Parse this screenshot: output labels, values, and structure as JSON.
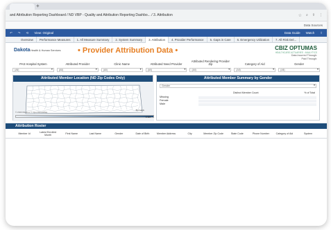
{
  "browser": {
    "url": "and Attribution Reporting Dashboard / ND VBP - Quality and Attribution Reporting Dashbo... / 3. Attribution",
    "right_items": [
      "Data Sources"
    ]
  },
  "toolbar": {
    "view": "View: Original",
    "data_guide": "Data Guide",
    "watch": "Watch"
  },
  "tabs": [
    {
      "label": "Overview",
      "active": false
    },
    {
      "label": "Performance Measures",
      "active": false
    },
    {
      "label": "1. All Measure Summary",
      "active": false
    },
    {
      "label": "2. System Summary",
      "active": false
    },
    {
      "label": "3. Attribution",
      "active": true
    },
    {
      "label": "4. Provider Performance",
      "active": false
    },
    {
      "label": "5. Gaps in Care",
      "active": false
    },
    {
      "label": "6. Emergency Utilization",
      "active": false
    },
    {
      "label": "7. All Risk Del...",
      "active": false
    }
  ],
  "header": {
    "logo": "Dakota",
    "logo_sub": "Health & Human Services",
    "title": "Provider Attribution Data",
    "title_decor": "•",
    "partner": "CBIZ OPTUMAS",
    "partner_sub": "HEALTHCARE ACTUARIES · ANALYTICS",
    "dates": [
      "Data Incurred Through:",
      "Paid Through:"
    ]
  },
  "filters": [
    {
      "label": "PAS Hospital System",
      "value": "(All)"
    },
    {
      "label": "Attributed Provider",
      "value": "(All)"
    },
    {
      "label": "Clinic Name",
      "value": "(All)"
    },
    {
      "label": "Attributed Need Provider",
      "value": "(All)"
    },
    {
      "label": "Attributed Rendering Provider Zip",
      "value": "(All)"
    },
    {
      "label": "Category of Aid",
      "value": "(All)"
    },
    {
      "label": "Gender",
      "value": "(All)"
    }
  ],
  "map_panel": {
    "title": "Attributed Member Location (ND Zip Codes Only)",
    "copyright": "© 2023 Mapbox © OpenStreetMap",
    "city": "Bismarck",
    "legend_max": "0.116"
  },
  "gender_panel": {
    "title": "Attributed Member Summary by Gender",
    "select": "Gender",
    "columns": [
      "Distinct Member Count",
      "% of Total"
    ],
    "rows": [
      "Missing",
      "Female",
      "Male"
    ]
  },
  "roster": {
    "title": "Attribution Roster",
    "columns": [
      "Member Id",
      "Latest Enrolled Month",
      "First Name",
      "Last Name",
      "Gender",
      "Date of Birth",
      "Member Address",
      "City",
      "Member Zip Code",
      "State Code",
      "Phone Number",
      "Category of Aid",
      "System"
    ]
  }
}
